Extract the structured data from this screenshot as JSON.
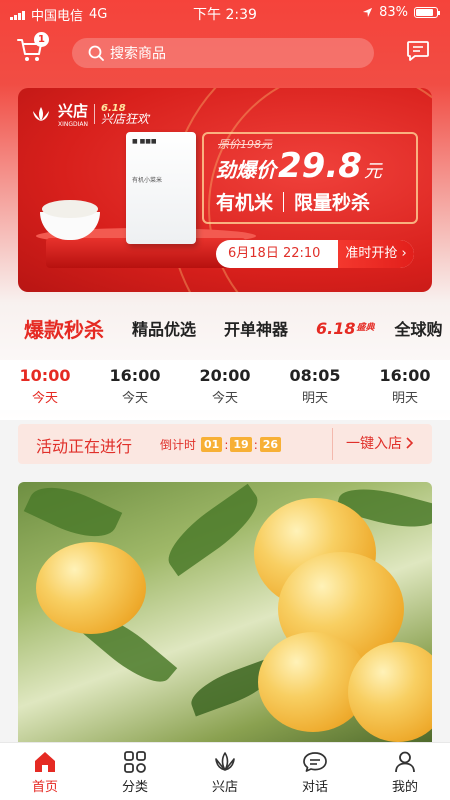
{
  "status_bar": {
    "carrier": "中国电信",
    "network": "4G",
    "time": "下午 2:39",
    "battery": "83%",
    "battery_level": 0.83
  },
  "top_bar": {
    "cart_badge": "1",
    "search_placeholder": "搜索商品"
  },
  "banner": {
    "brand_name": "兴店",
    "brand_pinyin": "XINGDIAN",
    "event_number": "6.18",
    "event_name": "兴店狂欢",
    "product_label": "有机小菜米",
    "original_price": "原价198元",
    "deal_label": "劲爆价",
    "deal_price": "29.8",
    "deal_unit": "元",
    "tagline_left": "有机米",
    "tagline_right": "限量秒杀",
    "start_time": "6月18日  22:10",
    "start_button": "准时开抢"
  },
  "tabs": [
    {
      "label": "爆款秒杀",
      "active": true
    },
    {
      "label": "精品优选",
      "active": false
    },
    {
      "label": "开单神器",
      "active": false
    },
    {
      "label": "6.18",
      "sub": "盛典",
      "active": false
    },
    {
      "label": "全球购",
      "active": false
    }
  ],
  "time_slots": [
    {
      "time": "10:00",
      "day": "今天",
      "active": true
    },
    {
      "time": "16:00",
      "day": "今天",
      "active": false
    },
    {
      "time": "20:00",
      "day": "今天",
      "active": false
    },
    {
      "time": "08:05",
      "day": "明天",
      "active": false
    },
    {
      "time": "16:00",
      "day": "明天",
      "active": false
    }
  ],
  "activity": {
    "status": "活动正在进行",
    "countdown_label": "倒计时",
    "hours": "01",
    "minutes": "19",
    "seconds": "26",
    "enter_label": "一键入店"
  },
  "bottom_nav": [
    {
      "label": "首页",
      "icon": "home-icon",
      "active": true
    },
    {
      "label": "分类",
      "icon": "category-icon",
      "active": false
    },
    {
      "label": "兴店",
      "icon": "lotus-icon",
      "active": false
    },
    {
      "label": "对话",
      "icon": "chat-icon",
      "active": false
    },
    {
      "label": "我的",
      "icon": "user-icon",
      "active": false
    }
  ],
  "colors": {
    "accent": "#e52a23",
    "header_red": "#f5433b",
    "countdown_box": "#f7b036"
  }
}
